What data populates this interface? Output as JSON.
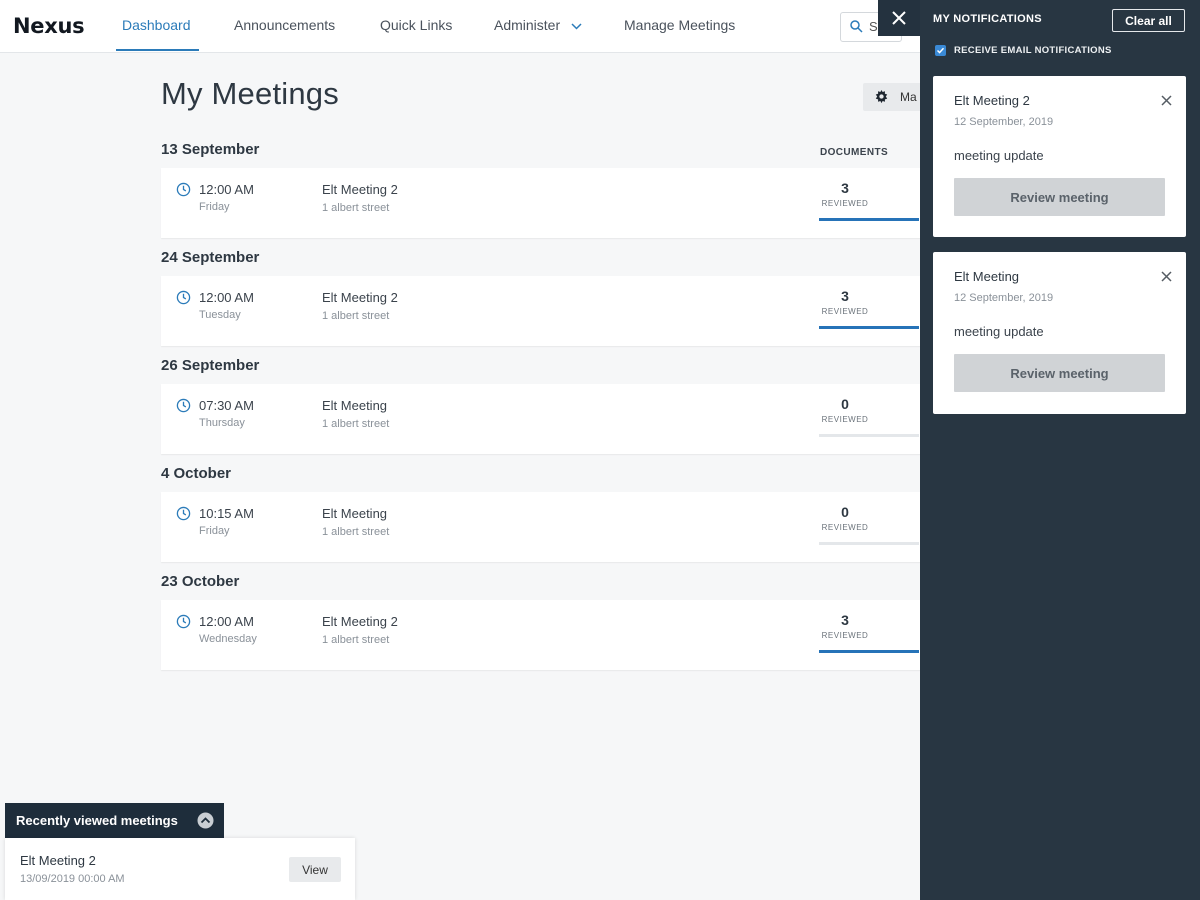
{
  "app": {
    "logo": "Nexus"
  },
  "nav": {
    "items": [
      "Dashboard",
      "Announcements",
      "Quick Links",
      "Administer",
      "Manage Meetings"
    ],
    "active": "Dashboard",
    "search_text": "S"
  },
  "main": {
    "title": "My Meetings",
    "manage_label": "Ma",
    "documents_header": "DOCUMENTS",
    "groups": [
      {
        "date": "13 September",
        "time": "12:00 AM",
        "day": "Friday",
        "title": "Elt Meeting 2",
        "location": "1 albert street",
        "count": "3",
        "reviewed_label": "REVIEWED",
        "progress": 1.0
      },
      {
        "date": "24 September",
        "time": "12:00 AM",
        "day": "Tuesday",
        "title": "Elt Meeting 2",
        "location": "1 albert street",
        "count": "3",
        "reviewed_label": "REVIEWED",
        "progress": 1.0
      },
      {
        "date": "26 September",
        "time": "07:30 AM",
        "day": "Thursday",
        "title": "Elt Meeting",
        "location": "1 albert street",
        "count": "0",
        "reviewed_label": "REVIEWED",
        "progress": 0
      },
      {
        "date": "4 October",
        "time": "10:15 AM",
        "day": "Friday",
        "title": "Elt Meeting",
        "location": "1 albert street",
        "count": "0",
        "reviewed_label": "REVIEWED",
        "progress": 0
      },
      {
        "date": "23 October",
        "time": "12:00 AM",
        "day": "Wednesday",
        "title": "Elt Meeting 2",
        "location": "1 albert street",
        "count": "3",
        "reviewed_label": "REVIEWED",
        "progress": 1.0
      }
    ]
  },
  "recent": {
    "tab_label": "Recently viewed meetings",
    "title": "Elt Meeting 2",
    "date": "13/09/2019 00:00 AM",
    "view_label": "View"
  },
  "notifications": {
    "title": "MY NOTIFICATIONS",
    "clear_label": "Clear all",
    "email_label": "RECEIVE EMAIL NOTIFICATIONS",
    "email_checked": true,
    "items": [
      {
        "title": "Elt Meeting 2",
        "date": "12 September, 2019",
        "message": "meeting update",
        "button": "Review meeting"
      },
      {
        "title": "Elt Meeting",
        "date": "12 September, 2019",
        "message": "meeting update",
        "button": "Review meeting"
      }
    ]
  },
  "colors": {
    "accent": "#2b7bb9",
    "progress": "#2673b8",
    "panel": "#283642",
    "dark_tab": "#1e2d3b"
  },
  "icons": [
    "search-icon",
    "close-icon",
    "chevron-down-icon",
    "gear-icon",
    "clock-icon",
    "chevron-up-icon",
    "checkbox-check-icon"
  ]
}
